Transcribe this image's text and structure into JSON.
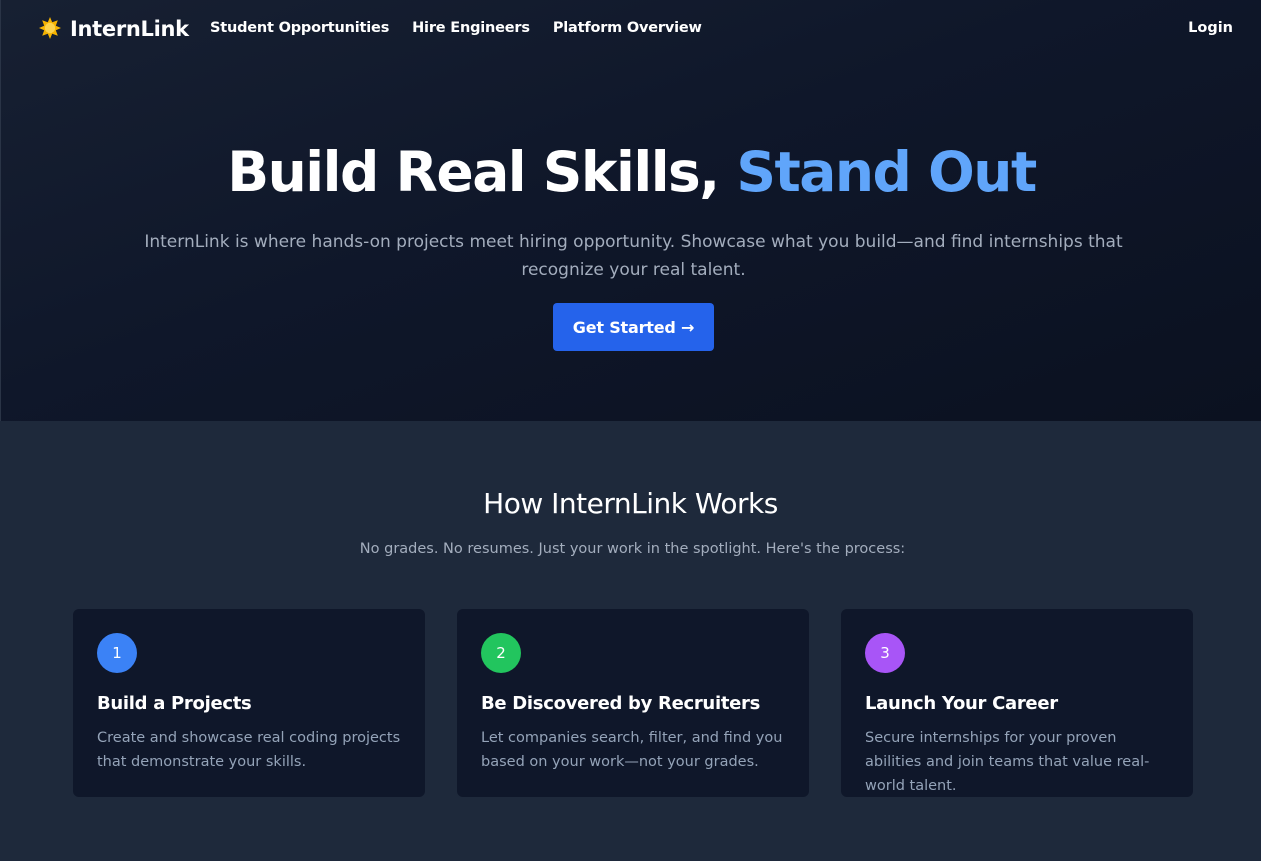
{
  "nav": {
    "logo_text": "InternLink",
    "logo_icon": "sun-icon",
    "links": [
      "Student Opportunities",
      "Hire Engineers",
      "Platform Overview"
    ],
    "login_label": "Login"
  },
  "hero": {
    "headline_main": "Build Real Skills,",
    "headline_accent": "Stand Out",
    "subtext": "InternLink is where hands-on projects meet hiring opportunity. Showcase what you build—and find internships that recognize your real talent.",
    "cta_label": "Get Started →"
  },
  "works": {
    "title": "How InternLink Works",
    "subtitle": "No grades. No resumes. Just your work in the spotlight. Here's the process:",
    "steps": [
      {
        "number": "1",
        "title": "Build a Projects",
        "text": "Create and showcase real coding projects that demonstrate your skills."
      },
      {
        "number": "2",
        "title": "Be Discovered by Recruiters",
        "text": "Let companies search, filter, and find you based on your work—not your grades."
      },
      {
        "number": "3",
        "title": "Launch Your Career",
        "text": "Secure internships for your proven abilities and join teams that value real-world talent."
      }
    ]
  },
  "colors": {
    "accent": "#60a5fa",
    "cta": "#2563eb",
    "step1": "#3b82f6",
    "step2": "#22c55e",
    "step3": "#a855f7"
  }
}
